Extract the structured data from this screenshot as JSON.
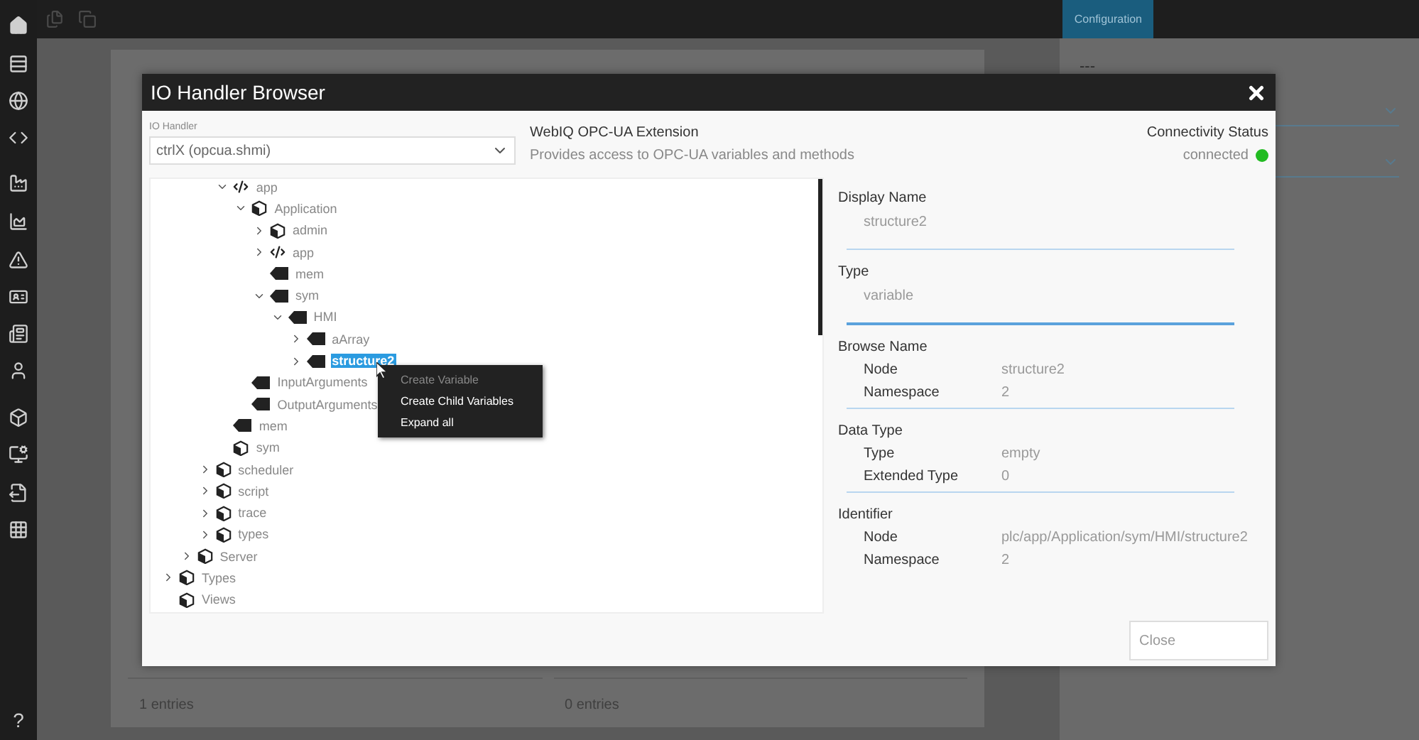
{
  "top_bar": {
    "tab": {
      "label": "Configuration",
      "selected": true
    }
  },
  "sidebar": {
    "help": "?"
  },
  "background": {
    "left_count": "1 entries",
    "right_count": "0 entries",
    "side_value": "---"
  },
  "dialog": {
    "title": "IO Handler Browser",
    "io_handler": {
      "label": "IO Handler",
      "value": "ctrlX (opcua.shmi)"
    },
    "extension": {
      "name": "WebIQ OPC-UA Extension",
      "description": "Provides access to OPC-UA variables and methods"
    },
    "connectivity": {
      "label": "Connectivity Status",
      "status": "connected",
      "color": "#22bb22"
    },
    "tree": [
      {
        "children": [
          {
            "children": [
              {
                "children": [
                  {
                    "label": "app",
                    "kind": "code",
                    "expanded": true,
                    "selected": false,
                    "children": [
                      {
                        "label": "Application",
                        "kind": "object",
                        "expanded": true,
                        "selected": false,
                        "children": [
                          {
                            "label": "admin",
                            "kind": "object",
                            "expanded": false,
                            "selected": false
                          },
                          {
                            "label": "app",
                            "kind": "code",
                            "expanded": false,
                            "selected": false
                          },
                          {
                            "label": "mem",
                            "kind": "variable",
                            "selected": false
                          },
                          {
                            "label": "sym",
                            "kind": "variable",
                            "expanded": true,
                            "selected": false,
                            "children": [
                              {
                                "label": "HMI",
                                "kind": "variable",
                                "expanded": true,
                                "selected": false,
                                "children": [
                                  {
                                    "label": "aArray",
                                    "kind": "variable",
                                    "expanded": false,
                                    "selected": false
                                  },
                                  {
                                    "label": "structure2",
                                    "kind": "variable",
                                    "expanded": false,
                                    "selected": true
                                  }
                                ]
                              }
                            ]
                          }
                        ]
                      },
                      {
                        "label": "InputArguments",
                        "kind": "variable",
                        "selected": false
                      },
                      {
                        "label": "OutputArguments",
                        "kind": "variable",
                        "selected": false
                      }
                    ]
                  },
                  {
                    "label": "mem",
                    "kind": "variable",
                    "selected": false
                  },
                  {
                    "label": "sym",
                    "kind": "object",
                    "selected": false
                  }
                ]
              },
              {
                "label": "scheduler",
                "kind": "object",
                "expanded": false,
                "selected": false
              },
              {
                "label": "script",
                "kind": "object",
                "expanded": false,
                "selected": false
              },
              {
                "label": "trace",
                "kind": "object",
                "expanded": false,
                "selected": false
              },
              {
                "label": "types",
                "kind": "object",
                "expanded": false,
                "selected": false
              }
            ]
          },
          {
            "label": "Server",
            "kind": "object",
            "expanded": false,
            "selected": false
          }
        ]
      },
      {
        "label": "Types",
        "kind": "object",
        "expanded": false,
        "selected": false
      },
      {
        "label": "Views",
        "kind": "object",
        "selected": false
      }
    ],
    "context_menu": [
      {
        "label": "Create Variable",
        "disabled": true
      },
      {
        "label": "Create Child Variables",
        "disabled": false
      },
      {
        "label": "Expand all",
        "disabled": false
      }
    ],
    "details": [
      {
        "title": "Display Name",
        "kind": "single",
        "value": "structure2",
        "focused": false
      },
      {
        "title": "Type",
        "kind": "single",
        "value": "variable",
        "focused": true
      },
      {
        "title": "Browse Name",
        "kind": "pairs",
        "focused": false,
        "rows": [
          {
            "key": "Node",
            "value": "structure2"
          },
          {
            "key": "Namespace",
            "value": "2"
          }
        ]
      },
      {
        "title": "Data Type",
        "kind": "pairs",
        "focused": false,
        "rows": [
          {
            "key": "Type",
            "value": "empty"
          },
          {
            "key": "Extended Type",
            "value": "0"
          }
        ]
      },
      {
        "title": "Identifier",
        "kind": "pairs",
        "rows": [
          {
            "key": "Node",
            "value": "plc/app/Application/sym/HMI/structure2"
          },
          {
            "key": "Namespace",
            "value": "2"
          }
        ]
      }
    ],
    "close_button": "Close"
  }
}
